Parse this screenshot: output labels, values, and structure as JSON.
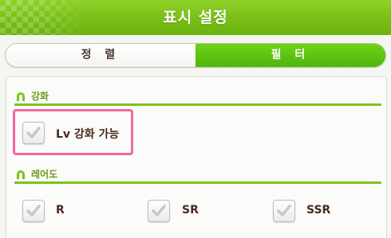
{
  "header": {
    "title": "표시 설정"
  },
  "tabs": [
    {
      "label": "정 렬",
      "active": false
    },
    {
      "label": "필 터",
      "active": true
    }
  ],
  "sections": [
    {
      "title": "강화",
      "options": [
        {
          "label": "Lv 강화 가능",
          "checked": true
        }
      ]
    },
    {
      "title": "레어도",
      "options": [
        {
          "label": "R",
          "checked": true
        },
        {
          "label": "SR",
          "checked": true
        },
        {
          "label": "SSR",
          "checked": true
        }
      ]
    }
  ],
  "colors": {
    "accent_green": "#78bf16",
    "section_text": "#6b9a1c",
    "highlight": "#ee6aa0",
    "label_text": "#4a2a1c"
  },
  "icons": {
    "section": "horseshoe-icon",
    "checkbox": "checkmark-icon"
  }
}
